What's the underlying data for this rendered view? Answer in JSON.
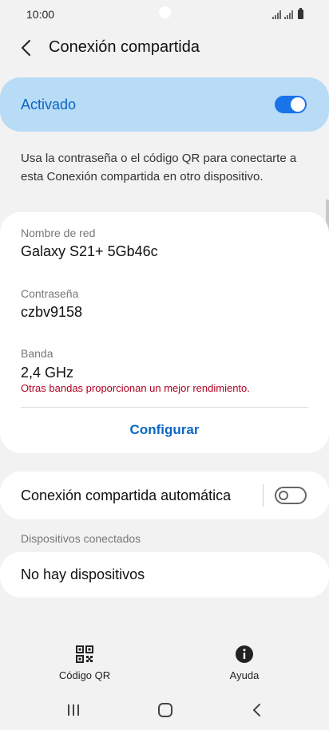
{
  "status_bar": {
    "time": "10:00"
  },
  "header": {
    "title": "Conexión compartida"
  },
  "activation": {
    "label": "Activado",
    "enabled": true
  },
  "description": "Usa la contraseña o el código QR para conectarte a esta Conexión compartida en otro dispositivo.",
  "network": {
    "name_label": "Nombre de red",
    "name_value": "Galaxy S21+ 5Gb46c",
    "password_label": "Contraseña",
    "password_value": "czbv9158",
    "band_label": "Banda",
    "band_value": "2,4 GHz",
    "band_warning": "Otras bandas proporcionan un mejor rendimiento.",
    "configure_label": "Configurar"
  },
  "auto_hotspot": {
    "label": "Conexión compartida automática",
    "enabled": false
  },
  "devices": {
    "section_label": "Dispositivos conectados",
    "empty_text": "No hay dispositivos"
  },
  "bottom_actions": {
    "qr_label": "Código QR",
    "help_label": "Ayuda"
  },
  "colors": {
    "accent": "#1a73e8",
    "banner_bg": "#b8dbf6",
    "warning": "#b00020"
  }
}
